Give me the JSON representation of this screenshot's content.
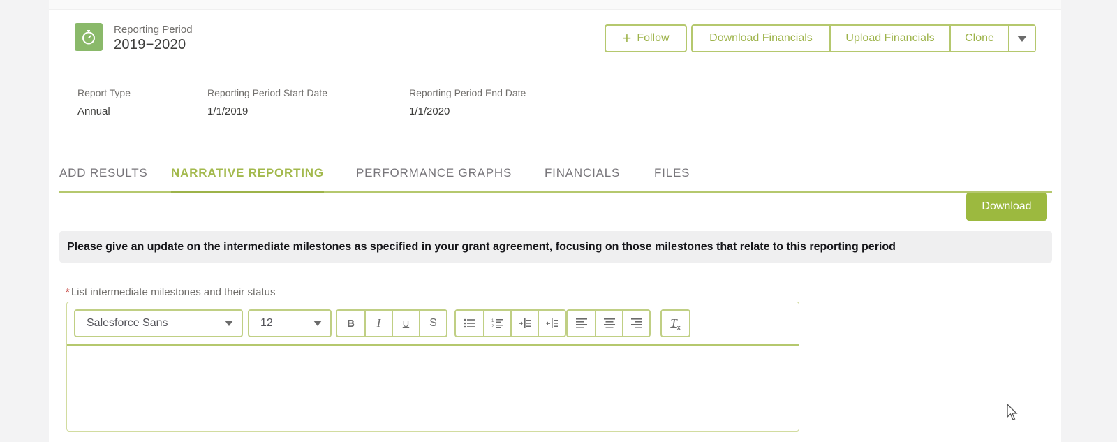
{
  "header": {
    "icon": "stopwatch-icon",
    "label": "Reporting Period",
    "value": "2019−2020"
  },
  "actions": {
    "follow_label": "Follow",
    "follow_icon": "plus-icon",
    "download_financials": "Download Financials",
    "upload_financials": "Upload Financials",
    "clone": "Clone",
    "more_icon": "caret-down-icon"
  },
  "details": [
    {
      "label": "Report Type",
      "value": "Annual"
    },
    {
      "label": "Reporting Period Start Date",
      "value": "1/1/2019"
    },
    {
      "label": "Reporting Period End Date",
      "value": "1/1/2020"
    }
  ],
  "tabs": [
    {
      "label": "ADD RESULTS",
      "active": false
    },
    {
      "label": "NARRATIVE REPORTING",
      "active": true
    },
    {
      "label": "PERFORMANCE GRAPHS",
      "active": false
    },
    {
      "label": "FINANCIALS",
      "active": false
    },
    {
      "label": "FILES",
      "active": false
    }
  ],
  "download_button": "Download",
  "question": "Please give an update on the intermediate milestones as specified in your grant agreement, focusing on those milestones that relate to this reporting period",
  "field": {
    "required_mark": "*",
    "label": "List intermediate milestones and their status",
    "value": ""
  },
  "editor": {
    "font_family": "Salesforce Sans",
    "font_size": "12",
    "buttons": {
      "bold": "B",
      "italic": "I",
      "underline": "U",
      "strikethrough": "S",
      "clear_format": "T"
    }
  },
  "colors": {
    "accent": "#9cb93f",
    "accent_border": "#b5c86e",
    "icon_tile": "#8ab96a",
    "question_bg": "#efeff0",
    "required": "#c23934"
  }
}
